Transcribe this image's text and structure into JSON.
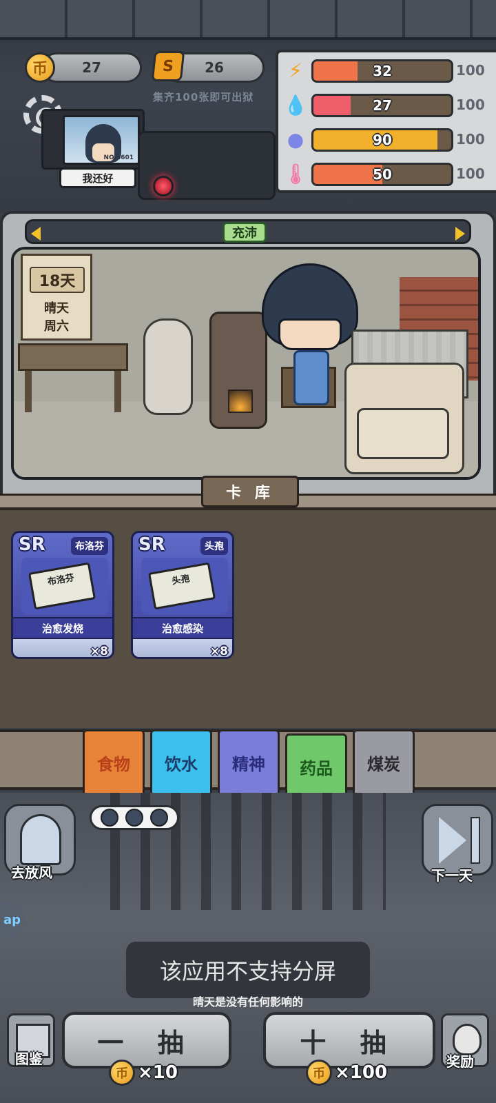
{
  "hud": {
    "coins": "27",
    "coin_icon": "币",
    "scards": "26",
    "scard_icon": "S",
    "hint": "集齐100张即可出狱",
    "prisoner_status": "我还好",
    "portrait_serial": "NO.4601"
  },
  "stats": [
    {
      "icon": "lightning-icon",
      "glyph": "⚡",
      "value": "32",
      "max": "100",
      "level": 0.32,
      "color": "#f0744a",
      "icon_color": "#f2a11a"
    },
    {
      "icon": "water-drop-icon",
      "glyph": "💧",
      "value": "27",
      "max": "100",
      "level": 0.27,
      "color": "#ef5e6a",
      "icon_color": "#3fa7e6"
    },
    {
      "icon": "brain-icon",
      "glyph": "●",
      "value": "90",
      "max": "100",
      "level": 0.9,
      "color": "#f2b12c",
      "icon_color": "#7c86e6"
    },
    {
      "icon": "thermometer-icon",
      "glyph": "🌡",
      "value": "50",
      "max": "100",
      "level": 0.5,
      "color": "#f0744a",
      "icon_color": "#f07aa8"
    }
  ],
  "room": {
    "state_tag": "充沛",
    "calendar_day": "18天",
    "calendar_weather": "晴天",
    "calendar_weekday": "周六"
  },
  "card_store": {
    "tab_label": "卡 库",
    "cards": [
      {
        "rarity": "SR",
        "name": "布洛芬",
        "box_text": "布洛芬",
        "effect": "治愈发烧",
        "count": "×8"
      },
      {
        "rarity": "SR",
        "name": "头孢",
        "box_text": "头孢",
        "effect": "治愈感染",
        "count": "×8"
      }
    ]
  },
  "categories": [
    {
      "label": "食物",
      "color": "#e8843a",
      "text_color": "#b8401a"
    },
    {
      "label": "饮水",
      "color": "#3cc0ee",
      "text_color": "#1e3c6a"
    },
    {
      "label": "精神",
      "color": "#7a7ed8",
      "text_color": "#2a2e7a"
    },
    {
      "label": "药品",
      "color": "#6fc86a",
      "text_color": "#1e5a1e"
    },
    {
      "label": "煤炭",
      "color": "#9a9aa2",
      "text_color": "#2a2a2e"
    }
  ],
  "actions": {
    "go_out": "去放风",
    "next_day": "下一天",
    "handbook": "图鉴",
    "reward": "奖励",
    "draw_one": "一 抽",
    "draw_ten": "十 抽",
    "draw_one_cost": "×10",
    "draw_ten_cost": "×100",
    "coin_icon": "币"
  },
  "toast": "该应用不支持分屏",
  "tip": "晴天是没有任何影响的",
  "app_badge": "ap"
}
